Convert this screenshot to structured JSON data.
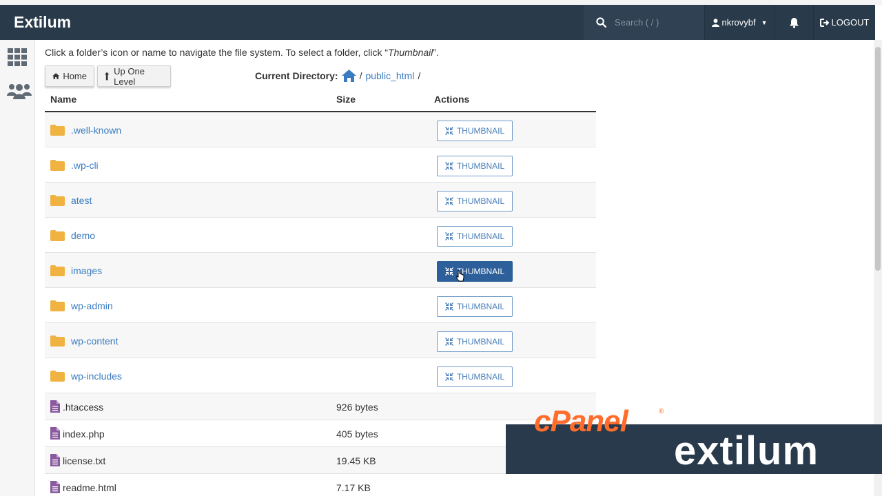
{
  "header": {
    "brand": "Extilum",
    "search_placeholder": "Search ( / )",
    "username": "nkrovybf",
    "logout_label": "LOGOUT"
  },
  "instructions": {
    "prefix": "Click a folder’s icon or name to navigate the file system. To select a folder, click “",
    "emphasis": "Thumbnail",
    "suffix": "”."
  },
  "nav": {
    "home_label": "Home",
    "up_label": "Up One Level"
  },
  "current_directory": {
    "label": "Current Directory:",
    "sep1": "/",
    "path": "public_html",
    "sep2": "/"
  },
  "table": {
    "columns": [
      "Name",
      "Size",
      "Actions"
    ],
    "thumbnail_label": "THUMBNAIL",
    "folders": [
      {
        "name": ".well-known"
      },
      {
        "name": ".wp-cli"
      },
      {
        "name": "atest"
      },
      {
        "name": "demo"
      },
      {
        "name": "images",
        "active": true
      },
      {
        "name": "wp-admin"
      },
      {
        "name": "wp-content"
      },
      {
        "name": "wp-includes"
      }
    ],
    "files": [
      {
        "name": ".htaccess",
        "size": "926 bytes"
      },
      {
        "name": "index.php",
        "size": "405 bytes"
      },
      {
        "name": "license.txt",
        "size": "19.45 KB"
      },
      {
        "name": "readme.html",
        "size": "7.17 KB"
      }
    ]
  },
  "overlay": {
    "cpanel_text": "cPanel",
    "extilum_text": "extilum"
  },
  "icons": {
    "search": "search-icon",
    "user": "user-icon",
    "bell": "bell-icon",
    "logout": "logout-icon",
    "grid": "grid-icon",
    "users": "users-icon",
    "home": "home-icon",
    "folder": "folder-icon",
    "file": "file-icon",
    "compress": "compress-icon"
  },
  "colors": {
    "topbar": "#293a4a",
    "link": "#3a7cc0",
    "folder": "#f0b341",
    "file": "#8a5a9e",
    "active_button": "#2d5f9a",
    "cpanel_orange": "#ff6c2c"
  }
}
